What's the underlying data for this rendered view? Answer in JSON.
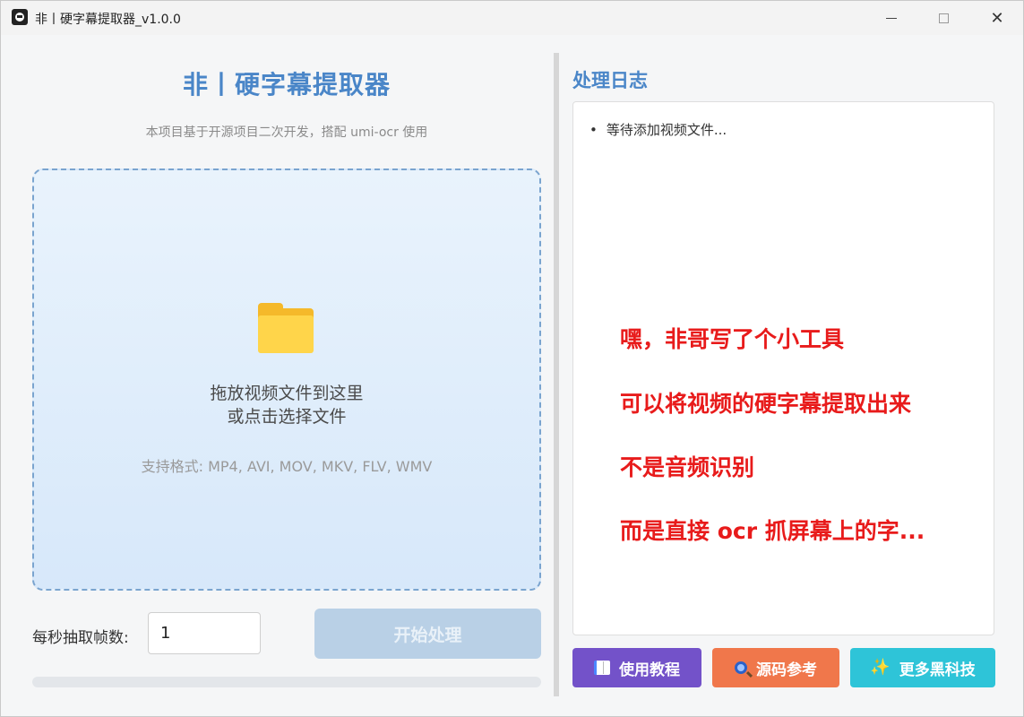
{
  "window": {
    "title": "非丨硬字幕提取器_v1.0.0",
    "close_glyph": "✕"
  },
  "main": {
    "title": "非丨硬字幕提取器",
    "subtitle": "本项目基于开源项目二次开发，搭配 umi-ocr 使用",
    "dropzone": {
      "line1": "拖放视频文件到这里",
      "line2": "或点击选择文件",
      "formats": "支持格式: MP4, AVI, MOV, MKV, FLV, WMV",
      "icon": "folder-icon"
    },
    "fps": {
      "label": "每秒抽取帧数:",
      "value": "1"
    },
    "start_label": "开始处理",
    "progress": 0
  },
  "log": {
    "title": "处理日志",
    "entries": [
      "等待添加视频文件..."
    ]
  },
  "overlay": {
    "lines": [
      "嘿，非哥写了个小工具",
      "可以将视频的硬字幕提取出来",
      "不是音频识别",
      "而是直接 ocr 抓屏幕上的字..."
    ]
  },
  "footer": {
    "tutorial": {
      "label": "使用教程",
      "icon": "book-icon"
    },
    "source": {
      "label": "源码参考",
      "icon": "magnifier-icon"
    },
    "more": {
      "label": "更多黑科技",
      "icon": "sparkles-icon",
      "glyph": "✨"
    }
  },
  "colors": {
    "accent": "#4a86c8",
    "overlay_red": "#e81b1b",
    "tutorial": "#7352c9",
    "source": "#f0774b",
    "more": "#2ec4d8"
  }
}
